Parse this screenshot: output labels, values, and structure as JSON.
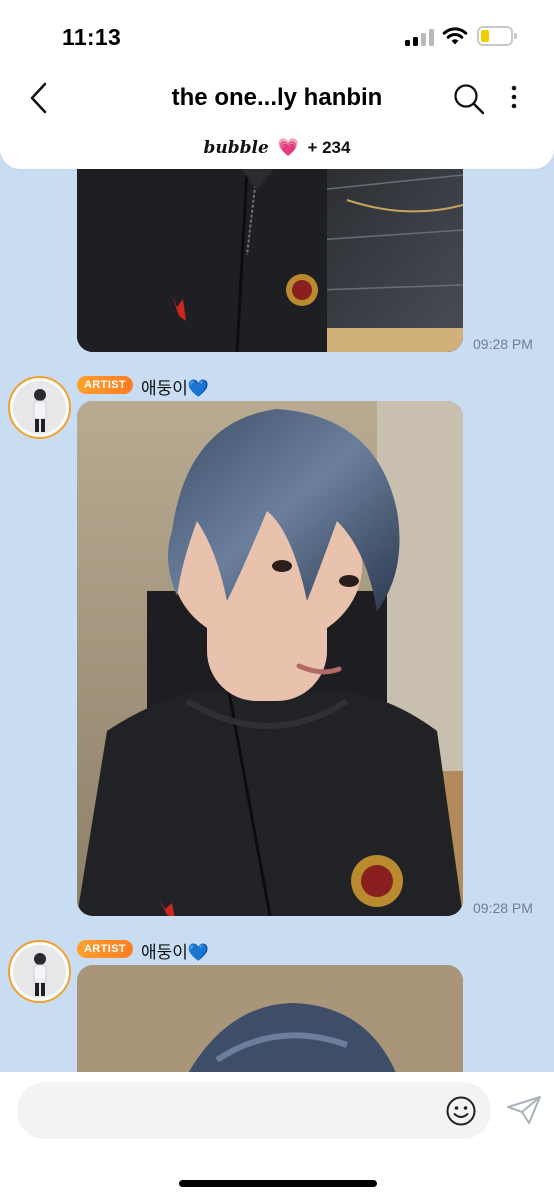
{
  "status_bar": {
    "time": "11:13",
    "battery_level": 0.28,
    "battery_color": "#f5cc00"
  },
  "header": {
    "title": "the one...ly hanbin",
    "brand": "bubble",
    "heart": "💗",
    "subscriber_count": "+ 234",
    "icons": [
      "chevron-left-icon",
      "search-icon",
      "more-vertical-icon"
    ]
  },
  "messages": [
    {
      "type": "image",
      "timestamp": "09:28 PM"
    },
    {
      "type": "image",
      "badge": "ARTIST",
      "sender": "애둥이",
      "sender_emoji": "💙",
      "timestamp": "09:28 PM"
    },
    {
      "type": "image",
      "badge": "ARTIST",
      "sender": "애둥이",
      "sender_emoji": "💙"
    }
  ],
  "composer": {
    "placeholder": "",
    "icons": [
      "emoji-icon",
      "send-icon"
    ]
  },
  "colors": {
    "chat_background": "#c8ddf2",
    "artist_badge": "#ff8a25",
    "avatar_ring": "#f0a030",
    "timestamp": "#6f7e8f"
  }
}
